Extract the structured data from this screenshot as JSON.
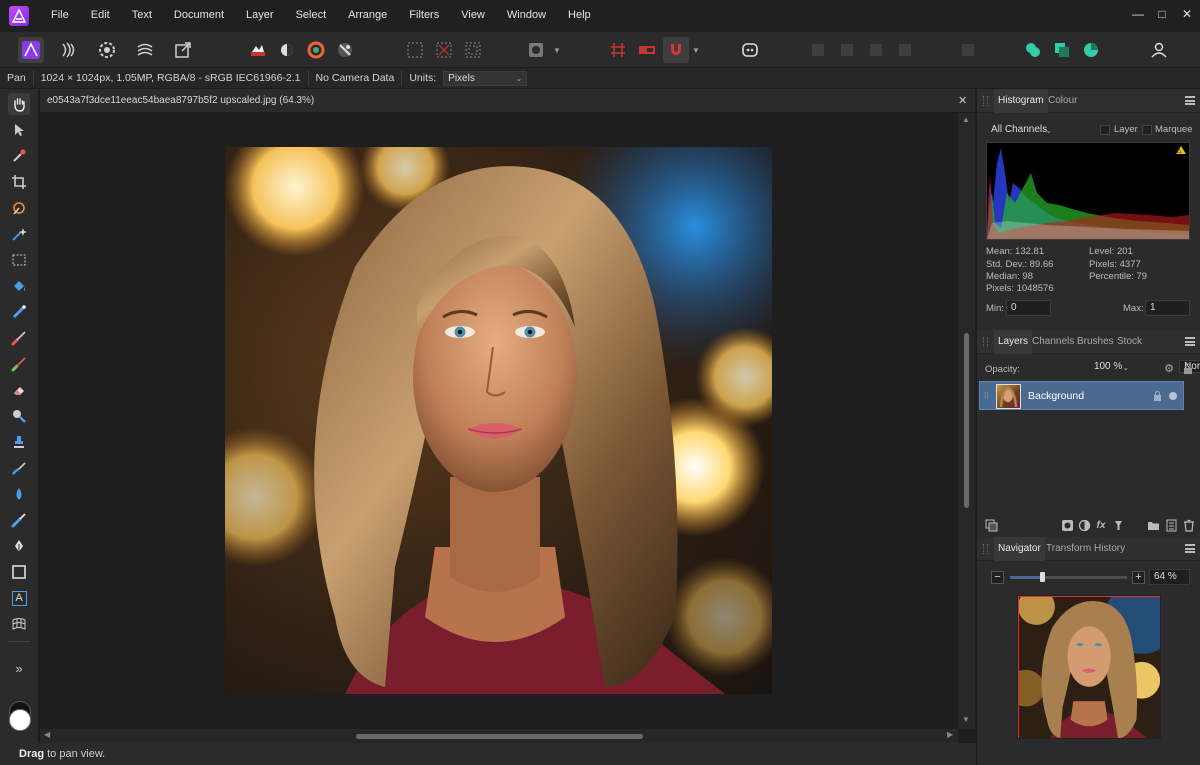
{
  "menubar": {
    "items": [
      "File",
      "Edit",
      "Text",
      "Document",
      "Layer",
      "Select",
      "Arrange",
      "Filters",
      "View",
      "Window",
      "Help"
    ],
    "minimize": "—",
    "maximize": "□",
    "close": "✕"
  },
  "context": {
    "tool_name": "Pan",
    "image_info": "1024 × 1024px, 1.05MP, RGBA/8 - sRGB IEC61966-2.1",
    "camera": "No Camera Data",
    "units_label": "Units:",
    "units_value": "Pixels"
  },
  "document": {
    "tab_title": "e0543a7f3dce11eeac54baea8797b5f2 upscaled.jpg (64.3%)",
    "close": "✕"
  },
  "status": {
    "bold": "Drag",
    "text": " to pan view."
  },
  "histogram": {
    "tabs": [
      "Histogram",
      "Colour"
    ],
    "channel": "All Channels",
    "layer_label": "Layer",
    "marquee_label": "Marquee",
    "warning": "⚠",
    "stats_left": [
      "Mean: 132.81",
      "Std. Dev.: 89.66",
      "Median: 98",
      "Pixels: 1048576"
    ],
    "stats_right": [
      "Level: 201",
      "Pixels: 4377",
      "Percentile: 79"
    ],
    "min_label": "Min:",
    "min_value": "0",
    "max_label": "Max:",
    "max_value": "1",
    "colors": {
      "red": "#c21b1b",
      "green": "#27b327",
      "blue": "#2b3fe0"
    }
  },
  "layers": {
    "tabs": [
      "Layers",
      "Channels",
      "Brushes",
      "Stock"
    ],
    "opacity_label": "Opacity:",
    "opacity_value": "100 %",
    "blend_mode": "Normal",
    "items": [
      {
        "name": "Background"
      }
    ]
  },
  "navigator": {
    "tabs": [
      "Navigator",
      "Transform",
      "History"
    ],
    "zoom_value": "64 %",
    "zoom_minus": "−",
    "zoom_plus": "+",
    "slider_fraction": 0.27
  },
  "icons": {
    "expand_tools": "»",
    "text_tool": "A"
  },
  "accent": "#4a6a92"
}
